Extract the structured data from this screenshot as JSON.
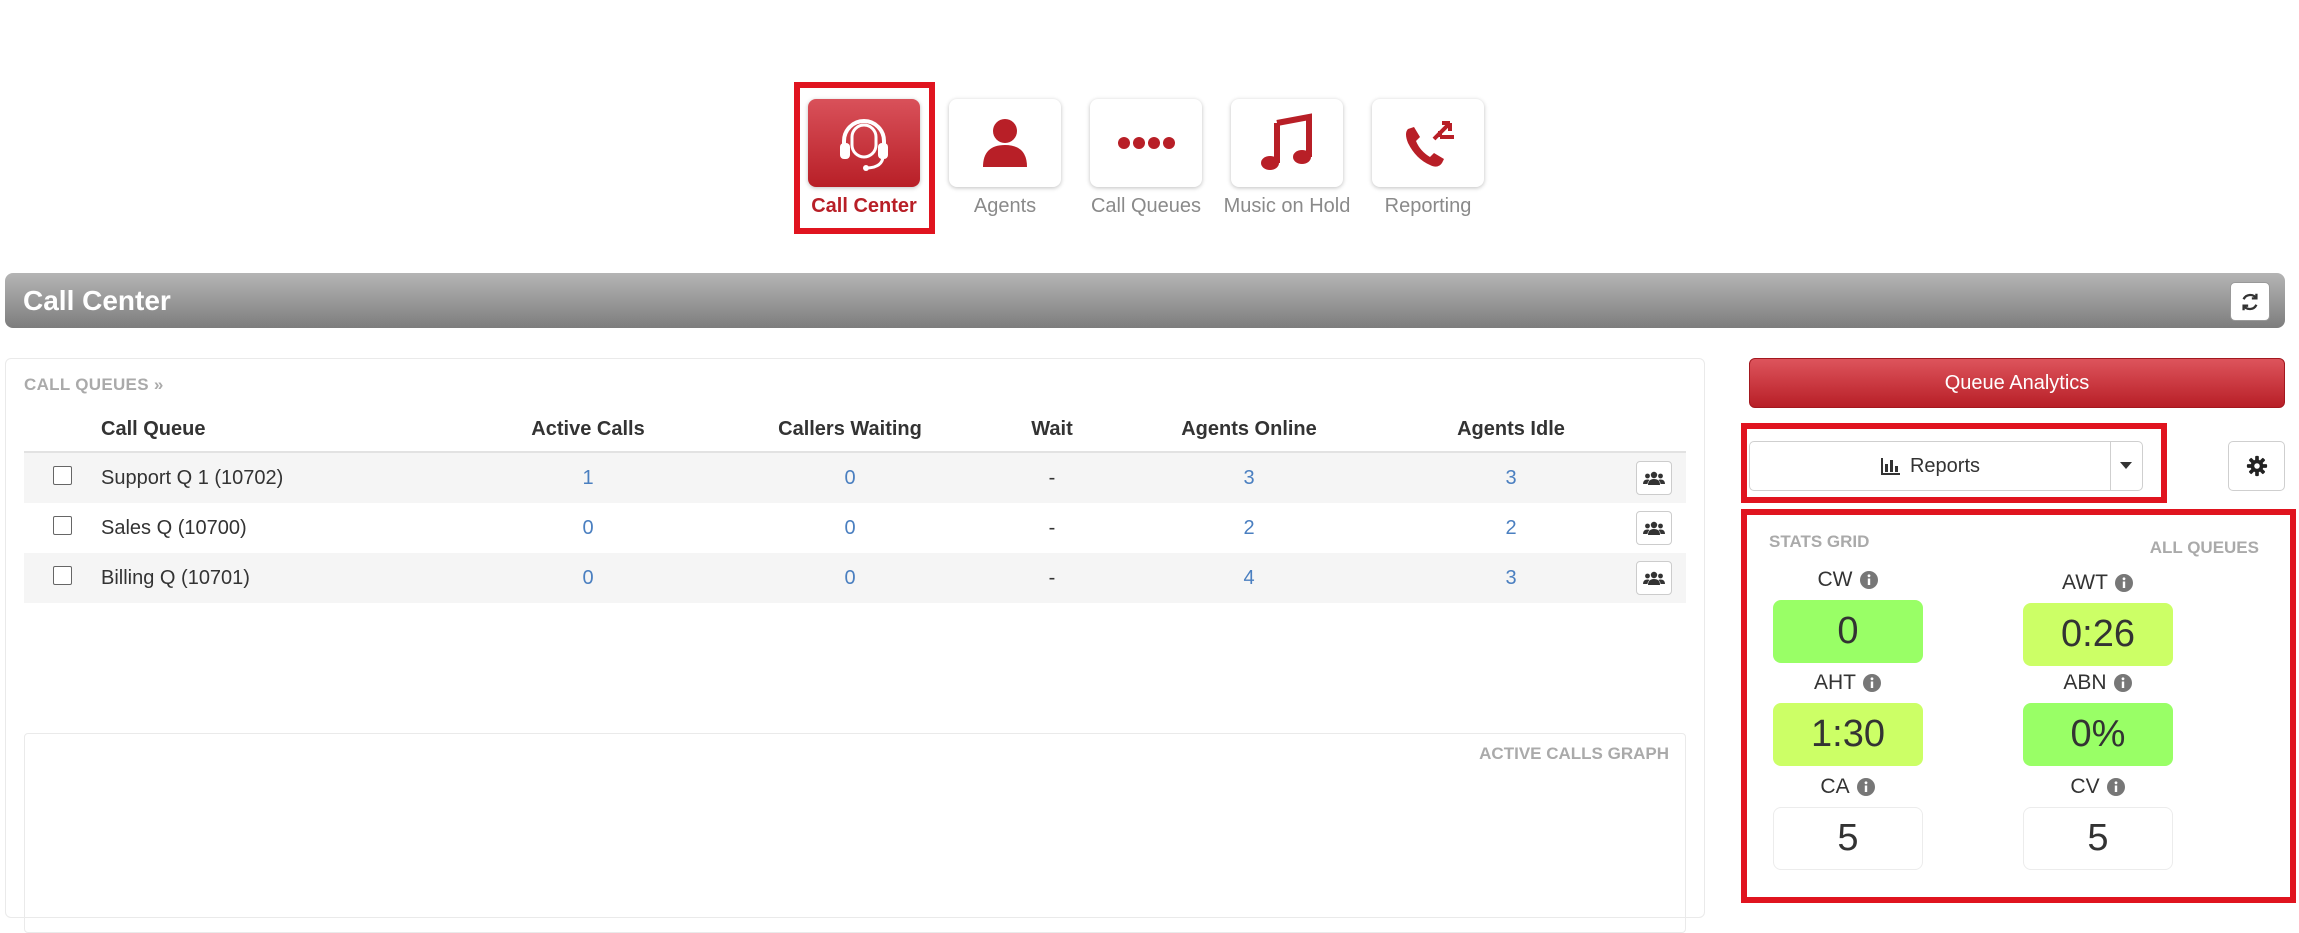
{
  "nav": {
    "items": [
      {
        "label": "Call Center",
        "icon": "headset-icon"
      },
      {
        "label": "Agents",
        "icon": "user-icon"
      },
      {
        "label": "Call Queues",
        "icon": "dots-icon"
      },
      {
        "label": "Music on Hold",
        "icon": "music-note-icon"
      },
      {
        "label": "Reporting",
        "icon": "phone-transfer-icon"
      }
    ]
  },
  "header": {
    "title": "Call Center"
  },
  "queues": {
    "section_title": "CALL QUEUES »",
    "columns": [
      "Call Queue",
      "Active Calls",
      "Callers Waiting",
      "Wait",
      "Agents Online",
      "Agents Idle"
    ],
    "rows": [
      {
        "name": "Support Q 1 (10702)",
        "active": "1",
        "waiting": "0",
        "wait": "-",
        "online": "3",
        "idle": "3"
      },
      {
        "name": "Sales Q (10700)",
        "active": "0",
        "waiting": "0",
        "wait": "-",
        "online": "2",
        "idle": "2"
      },
      {
        "name": "Billing Q (10701)",
        "active": "0",
        "waiting": "0",
        "wait": "-",
        "online": "4",
        "idle": "3"
      }
    ]
  },
  "graph": {
    "title": "ACTIVE CALLS GRAPH"
  },
  "right": {
    "analytics_label": "Queue Analytics",
    "reports_label": "Reports"
  },
  "stats": {
    "title": "STATS GRID",
    "scope": "ALL QUEUES",
    "items": [
      {
        "label": "CW",
        "value": "0",
        "color": "#99ff66"
      },
      {
        "label": "AWT",
        "value": "0:26",
        "color": "#ccff66"
      },
      {
        "label": "AHT",
        "value": "1:30",
        "color": "#ccff66"
      },
      {
        "label": "ABN",
        "value": "0%",
        "color": "#99ff66"
      },
      {
        "label": "CA",
        "value": "5",
        "color": "#ffffff"
      },
      {
        "label": "CV",
        "value": "5",
        "color": "#ffffff"
      }
    ]
  },
  "colors": {
    "brand_red": "#b81f27",
    "highlight": "#e0141f",
    "link_blue": "#4a7fc0"
  }
}
